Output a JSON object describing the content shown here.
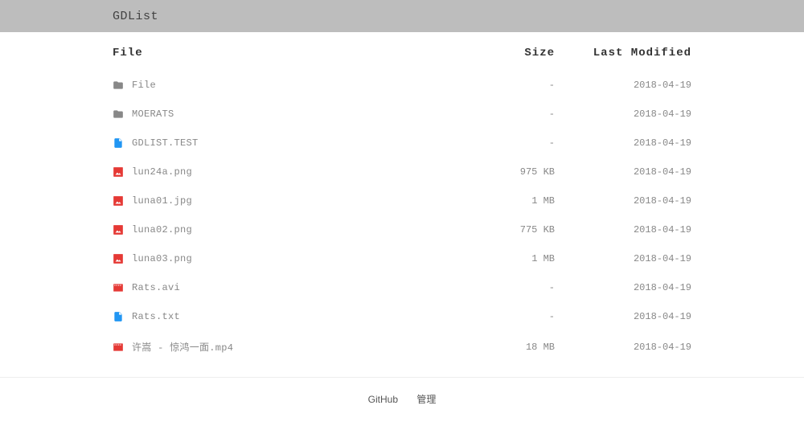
{
  "header": {
    "title": "GDList"
  },
  "columns": {
    "file": "File",
    "size": "Size",
    "modified": "Last Modified"
  },
  "rows": [
    {
      "icon": "folder",
      "name": "File",
      "size": "-",
      "modified": "2018-04-19"
    },
    {
      "icon": "folder",
      "name": "MOERATS",
      "size": "-",
      "modified": "2018-04-19"
    },
    {
      "icon": "doc",
      "name": "GDLIST.TEST",
      "size": "-",
      "modified": "2018-04-19"
    },
    {
      "icon": "image",
      "name": "lun24a.png",
      "size": "975 KB",
      "modified": "2018-04-19"
    },
    {
      "icon": "image",
      "name": "luna01.jpg",
      "size": "1 MB",
      "modified": "2018-04-19"
    },
    {
      "icon": "image",
      "name": "luna02.png",
      "size": "775 KB",
      "modified": "2018-04-19"
    },
    {
      "icon": "image",
      "name": "luna03.png",
      "size": "1 MB",
      "modified": "2018-04-19"
    },
    {
      "icon": "video",
      "name": "Rats.avi",
      "size": "-",
      "modified": "2018-04-19"
    },
    {
      "icon": "doc",
      "name": "Rats.txt",
      "size": "-",
      "modified": "2018-04-19"
    },
    {
      "icon": "video",
      "name": "许嵩 - 惊鸿一面.mp4",
      "size": "18 MB",
      "modified": "2018-04-19"
    }
  ],
  "footer": {
    "github": "GitHub",
    "admin": "管理"
  }
}
